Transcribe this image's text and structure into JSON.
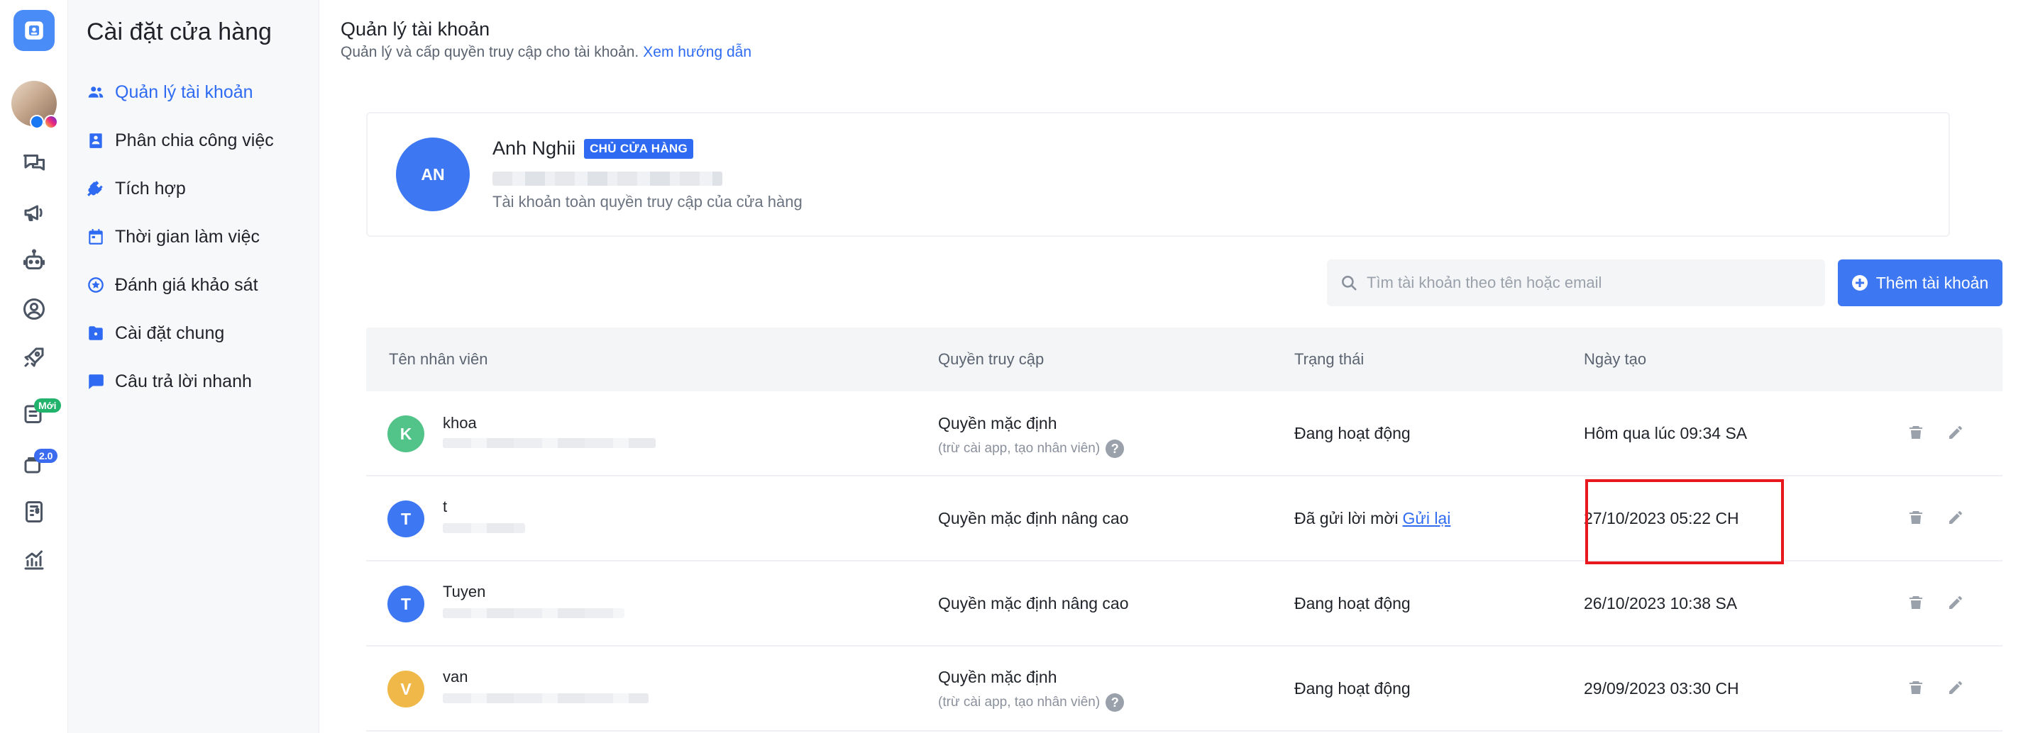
{
  "menu": {
    "title": "Cài đặt cửa hàng",
    "items": [
      {
        "label": "Quản lý tài khoản",
        "icon": "users-icon",
        "active": true
      },
      {
        "label": "Phân chia công việc",
        "icon": "assignment-icon",
        "active": false
      },
      {
        "label": "Tích hợp",
        "icon": "plug-icon",
        "active": false
      },
      {
        "label": "Thời gian làm việc",
        "icon": "calendar-icon",
        "active": false
      },
      {
        "label": "Đánh giá khảo sát",
        "icon": "star-badge-icon",
        "active": false
      },
      {
        "label": "Cài đặt chung",
        "icon": "folder-gear-icon",
        "active": false
      },
      {
        "label": "Câu trả lời nhanh",
        "icon": "chat-bubble-icon",
        "active": false
      }
    ]
  },
  "rail": {
    "badge_new": "Mới",
    "badge_version": "2.0"
  },
  "page": {
    "title": "Quản lý tài khoản",
    "subtitle": "Quản lý và cấp quyền truy cập cho tài khoản.",
    "guide_link": "Xem hướng dẫn"
  },
  "owner": {
    "initials": "AN",
    "name": "Anh Nghii",
    "role": "CHỦ CỬA HÀNG",
    "description": "Tài khoản toàn quyền truy cập của cửa hàng"
  },
  "search": {
    "placeholder": "Tìm tài khoản theo tên hoặc email"
  },
  "add_button": {
    "label": "Thêm tài khoản"
  },
  "table": {
    "headers": {
      "name": "Tên nhân viên",
      "access": "Quyền truy cập",
      "status": "Trạng thái",
      "created": "Ngày tạo"
    },
    "rows": [
      {
        "initial": "K",
        "avatar_color": "#52c48a",
        "name": "khoa",
        "access": "Quyền mặc định",
        "access_note": "(trừ cài app, tạo nhân viên)",
        "status": "Đang hoạt động",
        "status_link": "",
        "created": "Hôm qua lúc 09:34 SA"
      },
      {
        "initial": "T",
        "avatar_color": "#3d78f2",
        "name": "t",
        "access": "Quyền mặc định nâng cao",
        "access_note": "",
        "status": "Đã gửi lời mời",
        "status_link": "Gửi lại",
        "created": "27/10/2023 05:22 CH"
      },
      {
        "initial": "T",
        "avatar_color": "#3d78f2",
        "name": "Tuyen",
        "access": "Quyền mặc định nâng cao",
        "access_note": "",
        "status": "Đang hoạt động",
        "status_link": "",
        "created": "26/10/2023 10:38 SA"
      },
      {
        "initial": "V",
        "avatar_color": "#f0b849",
        "name": "van",
        "access": "Quyền mặc định",
        "access_note": "(trừ cài app, tạo nhân viên)",
        "status": "Đang hoạt động",
        "status_link": "",
        "created": "29/09/2023 03:30 CH"
      }
    ]
  },
  "colors": {
    "accent": "#2f6bf2",
    "highlight": "#e8181e"
  }
}
